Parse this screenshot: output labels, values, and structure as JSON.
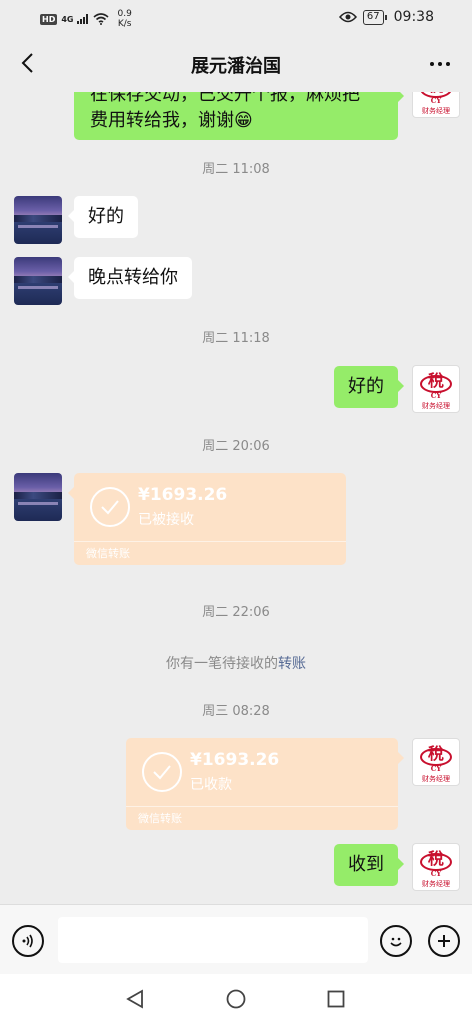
{
  "status_bar": {
    "hd": "HD",
    "network": "4G",
    "speed_value": "0.9",
    "speed_unit": "K/s",
    "battery": "67",
    "time": "09:38"
  },
  "header": {
    "title": "展元潘治国"
  },
  "messages": {
    "partial_line1": "在保存交动，已交升个报，麻烦把",
    "partial_line2": "费用转给我，谢谢😁",
    "ts1": "周二 11:08",
    "m1": "好的",
    "m2": "晚点转给你",
    "ts2": "周二 11:18",
    "m3": "好的",
    "ts3": "周二 20:06",
    "transfer1": {
      "amount": "¥1693.26",
      "status": "已被接收",
      "label": "微信转账"
    },
    "ts4": "周二 22:06",
    "notice_text": "你有一笔待接收的",
    "notice_link": "转账",
    "ts5": "周三 08:28",
    "transfer2": {
      "amount": "¥1693.26",
      "status": "已收款",
      "label": "微信转账"
    },
    "m4": "收到"
  },
  "logo": {
    "char": "稅",
    "cy": "CY",
    "text": "财务经理"
  },
  "input": {
    "placeholder": ""
  },
  "colors": {
    "green_bubble": "#95ec69",
    "transfer_bg": "#fde2c8",
    "link": "#576b95",
    "brand_red": "#c8102e"
  }
}
